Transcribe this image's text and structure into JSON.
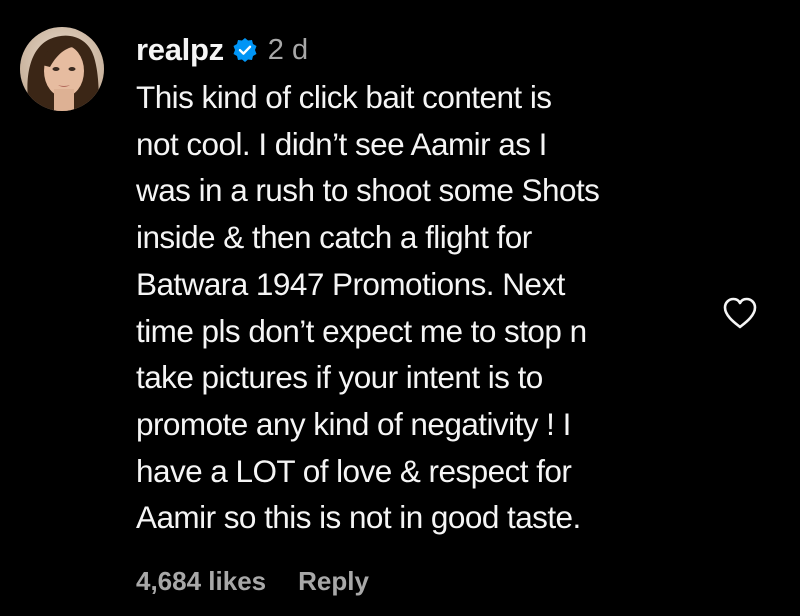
{
  "comment": {
    "username": "realpz",
    "timestamp": "2 d",
    "text_lines": [
      "This kind of click bait content is",
      "not cool. I didn’t see Aamir as I",
      "was in a rush to shoot some Shots",
      "inside & then catch a flight for",
      "Batwara 1947 Promotions. Next",
      "time pls don’t expect me to stop n",
      "take pictures if your intent is to",
      "promote any kind of negativity ! I",
      "have a LOT of love & respect for",
      "Aamir so this is not in good taste."
    ],
    "likes": "4,684 likes",
    "reply_label": "Reply"
  },
  "icons": {
    "verified": "verified-badge-icon",
    "like": "heart-icon"
  },
  "colors": {
    "background": "#000000",
    "primary_text": "#f5f5f5",
    "secondary_text": "#a8a8a8",
    "verified_blue": "#0095f6"
  }
}
